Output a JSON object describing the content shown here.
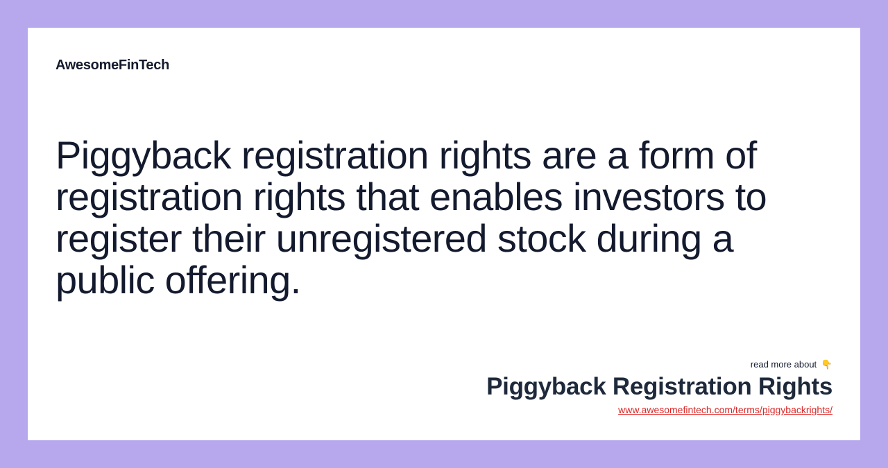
{
  "brand": {
    "name": "AwesomeFinTech"
  },
  "definition": {
    "text": "Piggyback registration rights are a form of registration rights that enables investors to register their unregistered stock during a public offering."
  },
  "footer": {
    "read_more": "read more about",
    "pointer_icon": "👇",
    "term_title": "Piggyback Registration Rights",
    "term_url": "www.awesomefintech.com/terms/piggybackrights/"
  },
  "colors": {
    "background": "#b7a8ee",
    "card": "#ffffff",
    "text": "#141a2e",
    "link": "#dc2626"
  }
}
